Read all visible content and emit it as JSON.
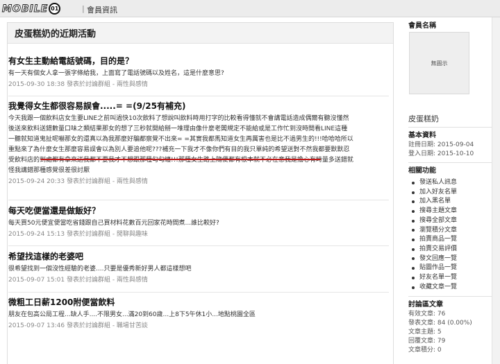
{
  "topbar": {
    "logo_text": "MOBILE",
    "logo_badge": "01",
    "nav_item": "會員資訊"
  },
  "main": {
    "title": "皮蛋糕奶的近期活動",
    "posts": [
      {
        "title": "有女生主動給電話號碼，目的是？",
        "excerpt": [
          "有一天有個女人拿一張字條給我，上面寫了電話號碼以及姓名，這是什麼意思?"
        ],
        "meta": "2015-09-30 18:38 發表於討論群組 - 兩性與感情"
      },
      {
        "title": "我覺得女生都很容易誤會.....= =(9/25有補充)",
        "excerpt": [
          "今天我跟一個飲料店女生要LINE之前叫過快10次飲料了想說叫飲料時用打字的比較看得懂就不會講電話造成偶爾有聽沒懂然",
          "後送來飲料送錯數量口味之類結果那女的想了三秒就開給掰一堆理由像什麼老闆規定不能給或是工作忙到沒時間看LINE這種",
          "一聽就知道鬼扯呢嚇那女的還真以為我那麼好騙都察覺不出來= =其實我都馬知道女生再厲害也是比不過男生的!!!哈哈哈所以",
          "重點來了為什麼女生那麼容易誤會以為別人要追他呢???補充一下我才不像你們有目的我只單純的希望送對不然我都要默默忍",
          "受飲料店的到處都有拿來送我都不要我才不想跟那種勾勾纏!!!那種女生路上隨便都有根本就不必在意我是擔心有時量多送錯就",
          "怪我講錯那種感覺很差很討厭"
        ],
        "meta": "2015-09-24 20:33 發表於討論群組 - 兩性與感情"
      },
      {
        "title": "每天吃便當還是做飯好？",
        "excerpt": [
          "每天買50元便宜便當吃省錢跟自己買材料花數百元回家花時間煮...誰比較好?"
        ],
        "meta": "2015-09-24 15:13 發表於討論群組 - 閒聊與趣味"
      },
      {
        "title": "希望找這樣的老婆吧",
        "excerpt": [
          "很希望找到一個沒性經驗的老婆....只要是優秀新好男人都這樣想吧"
        ],
        "meta": "2015-09-07 15:01 發表於討論群組 - 兩性與感情"
      },
      {
        "title": "微粗工日薪1200附便當飲料",
        "excerpt": [
          "朋友在包高公局工程...缺人手....不限男女...滿20到60歲...上8下5午休1小...地點桃園全區"
        ],
        "meta": "2015-09-07 13:46 發表於討論群組 - 職場甘苦談"
      }
    ]
  },
  "sidebar": {
    "member_name_heading": "會員名稱",
    "avatar_placeholder": "無圖示",
    "member_name": "皮蛋糕奶",
    "basic_heading": "基本資料",
    "register_date": "註冊日期: 2015-09-04",
    "login_date": "登入日期: 2015-10-10",
    "functions_heading": "相關功能",
    "functions": [
      "發送私人訊息",
      "加入好友名單",
      "加入黑名單",
      "搜尋主題文章",
      "搜尋全部文章",
      "瀏覽積分文章",
      "拍賣商品一覽",
      "拍賣交易評價",
      "發文回應一覽",
      "貼圖作品一覽",
      "好友名單一覽",
      "收藏文章一覽"
    ],
    "forum_heading": "討論區文章",
    "forum_stats": [
      "有效文章: 76",
      "發表文章: 84 (0.00%)",
      "文章主題: 5",
      "回覆文章: 79",
      "文章積分: 0"
    ]
  }
}
